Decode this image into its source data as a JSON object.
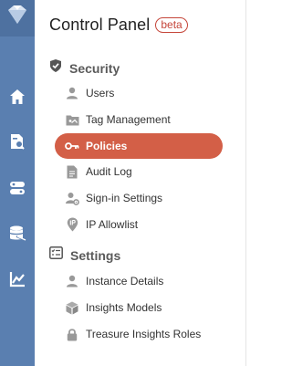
{
  "panel": {
    "title": "Control Panel",
    "badge": "beta"
  },
  "colors": {
    "rail": "#5a7fb0",
    "accent": "#d35f47",
    "badge": "#c5463a"
  },
  "rail": {
    "items": [
      {
        "icon": "home-icon"
      },
      {
        "icon": "data-workbench-icon"
      },
      {
        "icon": "integrations-icon"
      },
      {
        "icon": "database-icon"
      },
      {
        "icon": "insights-chart-icon"
      }
    ]
  },
  "sections": [
    {
      "label": "Security",
      "icon": "shield-check-icon",
      "items": [
        {
          "label": "Users",
          "icon": "user-icon"
        },
        {
          "label": "Tag Management",
          "icon": "tag-folder-icon"
        },
        {
          "label": "Policies",
          "icon": "key-icon",
          "active": true
        },
        {
          "label": "Audit Log",
          "icon": "document-icon"
        },
        {
          "label": "Sign-in Settings",
          "icon": "user-gear-icon"
        },
        {
          "label": "IP Allowlist",
          "icon": "ip-location-icon"
        }
      ]
    },
    {
      "label": "Settings",
      "icon": "settings-list-icon",
      "items": [
        {
          "label": "Instance Details",
          "icon": "user-icon"
        },
        {
          "label": "Insights Models",
          "icon": "cube-icon"
        },
        {
          "label": "Treasure Insights Roles",
          "icon": "lock-icon"
        }
      ]
    }
  ]
}
